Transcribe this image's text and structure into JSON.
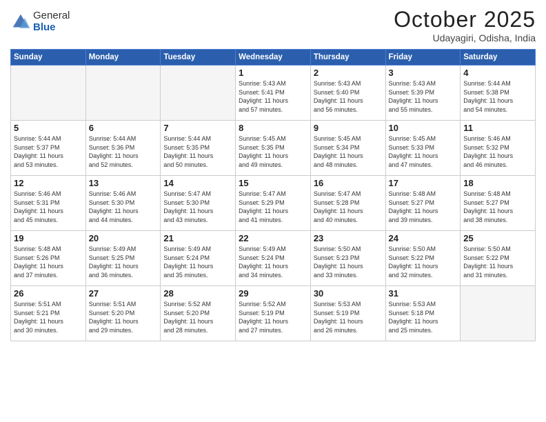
{
  "header": {
    "logo_general": "General",
    "logo_blue": "Blue",
    "month_title": "October 2025",
    "location": "Udayagiri, Odisha, India"
  },
  "weekdays": [
    "Sunday",
    "Monday",
    "Tuesday",
    "Wednesday",
    "Thursday",
    "Friday",
    "Saturday"
  ],
  "rows": [
    [
      {
        "day": "",
        "text": ""
      },
      {
        "day": "",
        "text": ""
      },
      {
        "day": "",
        "text": ""
      },
      {
        "day": "1",
        "text": "Sunrise: 5:43 AM\nSunset: 5:41 PM\nDaylight: 11 hours\nand 57 minutes."
      },
      {
        "day": "2",
        "text": "Sunrise: 5:43 AM\nSunset: 5:40 PM\nDaylight: 11 hours\nand 56 minutes."
      },
      {
        "day": "3",
        "text": "Sunrise: 5:43 AM\nSunset: 5:39 PM\nDaylight: 11 hours\nand 55 minutes."
      },
      {
        "day": "4",
        "text": "Sunrise: 5:44 AM\nSunset: 5:38 PM\nDaylight: 11 hours\nand 54 minutes."
      }
    ],
    [
      {
        "day": "5",
        "text": "Sunrise: 5:44 AM\nSunset: 5:37 PM\nDaylight: 11 hours\nand 53 minutes."
      },
      {
        "day": "6",
        "text": "Sunrise: 5:44 AM\nSunset: 5:36 PM\nDaylight: 11 hours\nand 52 minutes."
      },
      {
        "day": "7",
        "text": "Sunrise: 5:44 AM\nSunset: 5:35 PM\nDaylight: 11 hours\nand 50 minutes."
      },
      {
        "day": "8",
        "text": "Sunrise: 5:45 AM\nSunset: 5:35 PM\nDaylight: 11 hours\nand 49 minutes."
      },
      {
        "day": "9",
        "text": "Sunrise: 5:45 AM\nSunset: 5:34 PM\nDaylight: 11 hours\nand 48 minutes."
      },
      {
        "day": "10",
        "text": "Sunrise: 5:45 AM\nSunset: 5:33 PM\nDaylight: 11 hours\nand 47 minutes."
      },
      {
        "day": "11",
        "text": "Sunrise: 5:46 AM\nSunset: 5:32 PM\nDaylight: 11 hours\nand 46 minutes."
      }
    ],
    [
      {
        "day": "12",
        "text": "Sunrise: 5:46 AM\nSunset: 5:31 PM\nDaylight: 11 hours\nand 45 minutes."
      },
      {
        "day": "13",
        "text": "Sunrise: 5:46 AM\nSunset: 5:30 PM\nDaylight: 11 hours\nand 44 minutes."
      },
      {
        "day": "14",
        "text": "Sunrise: 5:47 AM\nSunset: 5:30 PM\nDaylight: 11 hours\nand 43 minutes."
      },
      {
        "day": "15",
        "text": "Sunrise: 5:47 AM\nSunset: 5:29 PM\nDaylight: 11 hours\nand 41 minutes."
      },
      {
        "day": "16",
        "text": "Sunrise: 5:47 AM\nSunset: 5:28 PM\nDaylight: 11 hours\nand 40 minutes."
      },
      {
        "day": "17",
        "text": "Sunrise: 5:48 AM\nSunset: 5:27 PM\nDaylight: 11 hours\nand 39 minutes."
      },
      {
        "day": "18",
        "text": "Sunrise: 5:48 AM\nSunset: 5:27 PM\nDaylight: 11 hours\nand 38 minutes."
      }
    ],
    [
      {
        "day": "19",
        "text": "Sunrise: 5:48 AM\nSunset: 5:26 PM\nDaylight: 11 hours\nand 37 minutes."
      },
      {
        "day": "20",
        "text": "Sunrise: 5:49 AM\nSunset: 5:25 PM\nDaylight: 11 hours\nand 36 minutes."
      },
      {
        "day": "21",
        "text": "Sunrise: 5:49 AM\nSunset: 5:24 PM\nDaylight: 11 hours\nand 35 minutes."
      },
      {
        "day": "22",
        "text": "Sunrise: 5:49 AM\nSunset: 5:24 PM\nDaylight: 11 hours\nand 34 minutes."
      },
      {
        "day": "23",
        "text": "Sunrise: 5:50 AM\nSunset: 5:23 PM\nDaylight: 11 hours\nand 33 minutes."
      },
      {
        "day": "24",
        "text": "Sunrise: 5:50 AM\nSunset: 5:22 PM\nDaylight: 11 hours\nand 32 minutes."
      },
      {
        "day": "25",
        "text": "Sunrise: 5:50 AM\nSunset: 5:22 PM\nDaylight: 11 hours\nand 31 minutes."
      }
    ],
    [
      {
        "day": "26",
        "text": "Sunrise: 5:51 AM\nSunset: 5:21 PM\nDaylight: 11 hours\nand 30 minutes."
      },
      {
        "day": "27",
        "text": "Sunrise: 5:51 AM\nSunset: 5:20 PM\nDaylight: 11 hours\nand 29 minutes."
      },
      {
        "day": "28",
        "text": "Sunrise: 5:52 AM\nSunset: 5:20 PM\nDaylight: 11 hours\nand 28 minutes."
      },
      {
        "day": "29",
        "text": "Sunrise: 5:52 AM\nSunset: 5:19 PM\nDaylight: 11 hours\nand 27 minutes."
      },
      {
        "day": "30",
        "text": "Sunrise: 5:53 AM\nSunset: 5:19 PM\nDaylight: 11 hours\nand 26 minutes."
      },
      {
        "day": "31",
        "text": "Sunrise: 5:53 AM\nSunset: 5:18 PM\nDaylight: 11 hours\nand 25 minutes."
      },
      {
        "day": "",
        "text": ""
      }
    ]
  ]
}
